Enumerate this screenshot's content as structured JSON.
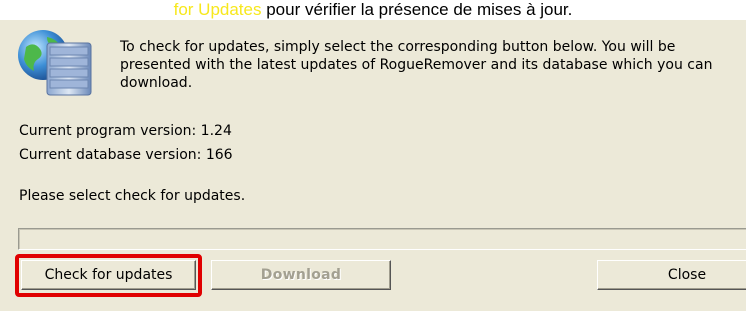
{
  "caption": {
    "highlight_text": "for Updates",
    "rest_text": " pour vérifier la présence de mises à jour."
  },
  "dialog": {
    "intro_text": "To check for updates, simply select the corresponding button below. You will be presented with the latest updates of RogueRemover and its database which you can download.",
    "program_version": "Current program version: 1.24",
    "database_version": "Current database version: 166",
    "status_text": "Please select check for updates.",
    "progress": 0,
    "icon": "globe-database-icon",
    "buttons": {
      "check": "Check for updates",
      "download": "Download",
      "close": "Close"
    }
  },
  "colors": {
    "dialog_bg": "#ece9d8",
    "caption_highlight": "#f7e81d",
    "annotation_box": "#e00000"
  }
}
